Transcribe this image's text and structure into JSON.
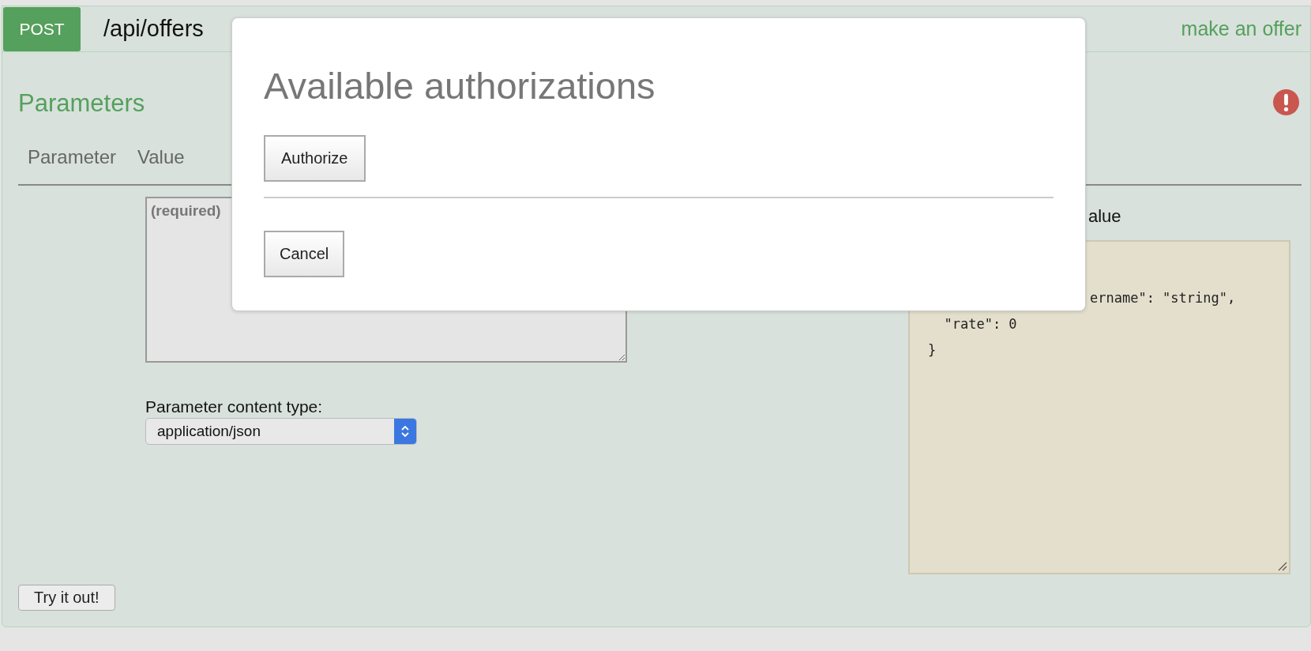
{
  "endpoint": {
    "method": "POST",
    "path": "/api/offers",
    "summary": "make an offer"
  },
  "parameters": {
    "title": "Parameters",
    "error": true,
    "columns": [
      "Parameter",
      "Value"
    ],
    "body_field": {
      "placeholder": "(required)"
    },
    "content_type": {
      "label": "Parameter content type:",
      "value": "application/json"
    },
    "example": {
      "label": "alue",
      "code_lines": [
        "ername\": \"string\",",
        "  \"rate\": 0",
        "}"
      ]
    }
  },
  "try_button": "Try it out!",
  "modal": {
    "title": "Available authorizations",
    "buttons": [
      "Authorize",
      "Cancel"
    ]
  }
}
